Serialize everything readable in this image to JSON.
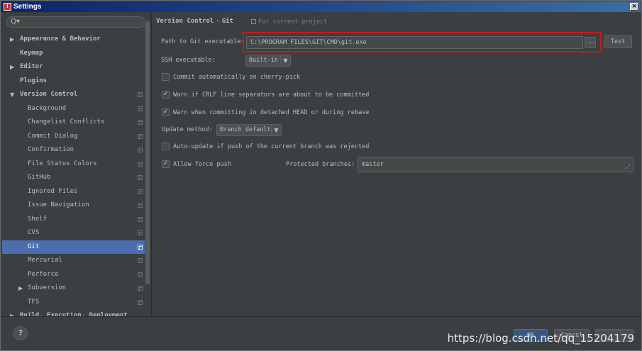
{
  "window": {
    "title": "Settings",
    "close_glyph": "×"
  },
  "search": {
    "icon": "Q▾"
  },
  "sidebar": {
    "items": [
      {
        "label": "Appearance & Behavior",
        "level": 0,
        "arrow": "▶"
      },
      {
        "label": "Keymap",
        "level": 0,
        "arrow": ""
      },
      {
        "label": "Editor",
        "level": 0,
        "arrow": "▶"
      },
      {
        "label": "Plugins",
        "level": 0,
        "arrow": ""
      },
      {
        "label": "Version Control",
        "level": 0,
        "arrow": "▼",
        "copy": true
      },
      {
        "label": "Background",
        "level": 1,
        "copy": true
      },
      {
        "label": "Changelist Conflicts",
        "level": 1,
        "copy": true
      },
      {
        "label": "Commit Dialog",
        "level": 1,
        "copy": true
      },
      {
        "label": "Confirmation",
        "level": 1,
        "copy": true
      },
      {
        "label": "File Status Colors",
        "level": 1,
        "copy": true
      },
      {
        "label": "GitHub",
        "level": 1,
        "copy": true
      },
      {
        "label": "Ignored Files",
        "level": 1,
        "copy": true
      },
      {
        "label": "Issue Navigation",
        "level": 1,
        "copy": true
      },
      {
        "label": "Shelf",
        "level": 1,
        "copy": true
      },
      {
        "label": "CVS",
        "level": 1,
        "copy": true
      },
      {
        "label": "Git",
        "level": 1,
        "copy": true,
        "selected": true
      },
      {
        "label": "Mercurial",
        "level": 1,
        "copy": true
      },
      {
        "label": "Perforce",
        "level": 1,
        "copy": true
      },
      {
        "label": "Subversion",
        "level": 1,
        "arrow": "▶",
        "copy": true
      },
      {
        "label": "TFS",
        "level": 1,
        "copy": true
      },
      {
        "label": "Build, Execution, Deployment",
        "level": 0,
        "arrow": "▶"
      }
    ]
  },
  "breadcrumb": {
    "parent": "Version Control",
    "separator": "›",
    "current": "Git",
    "scope": "For current project"
  },
  "git": {
    "path_label": "Path to Git executable:",
    "path_value": "C:\\PROGRAM FILES\\GIT\\CMD\\git.exe",
    "browse_label": "...",
    "test_label": "Test",
    "ssh_label": "SSH executable:",
    "ssh_value": "Built-in",
    "commit_cherry_pick": {
      "label": "Commit automatically on cherry-pick",
      "checked": false
    },
    "warn_crlf": {
      "label": "Warn if CRLF line separators are about to be committed",
      "checked": true
    },
    "warn_detached": {
      "label": "Warn when committing in detached HEAD or during rebase",
      "checked": true
    },
    "update_method_label": "Update method:",
    "update_method_value": "Branch default",
    "auto_update": {
      "label": "Auto-update if push of the current branch was rejected",
      "checked": false
    },
    "allow_force_push": {
      "label": "Allow force push",
      "checked": true
    },
    "protected_label": "Protected branches:",
    "protected_value": "master"
  },
  "buttons": {
    "ok": "OK",
    "cancel": "Cancel",
    "help": "?"
  },
  "watermark": "https://blog.csdn.net/qq_15204179",
  "colors": {
    "accent": "#4b6eaf",
    "background": "#3c3f41",
    "highlight_outline": "#c91a1a"
  }
}
